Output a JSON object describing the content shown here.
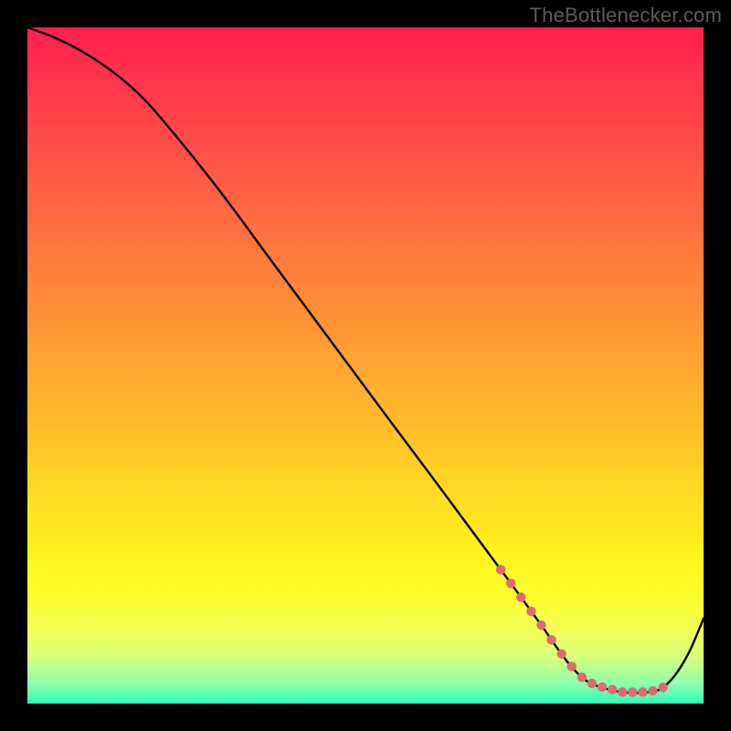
{
  "watermark": "TheBottlenecker.com",
  "chart_data": {
    "type": "line",
    "title": "",
    "xlabel": "",
    "ylabel": "",
    "xlim": [
      0,
      100
    ],
    "ylim": [
      0,
      100
    ],
    "series": [
      {
        "name": "curve",
        "x": [
          0,
          4,
          8,
          12,
          16,
          20,
          28,
          36,
          44,
          52,
          60,
          68,
          72,
          76,
          78,
          80,
          82,
          84,
          88,
          92,
          94,
          96,
          98,
          100
        ],
        "y": [
          100,
          98.5,
          96.5,
          93.9,
          90.6,
          86.3,
          76.4,
          65.6,
          54.8,
          44.0,
          33.3,
          22.5,
          17.1,
          11.6,
          8.7,
          6.0,
          3.9,
          2.7,
          1.7,
          1.7,
          2.4,
          4.5,
          7.9,
          12.6
        ]
      }
    ],
    "annotations": {
      "dot_segment": {
        "x_start": 70,
        "x_end": 94
      }
    },
    "colors": {
      "line": "#000000",
      "dots": "#e06a6f",
      "gradient_top": "#ff1f4f",
      "gradient_bottom": "#2cfbb8"
    }
  }
}
